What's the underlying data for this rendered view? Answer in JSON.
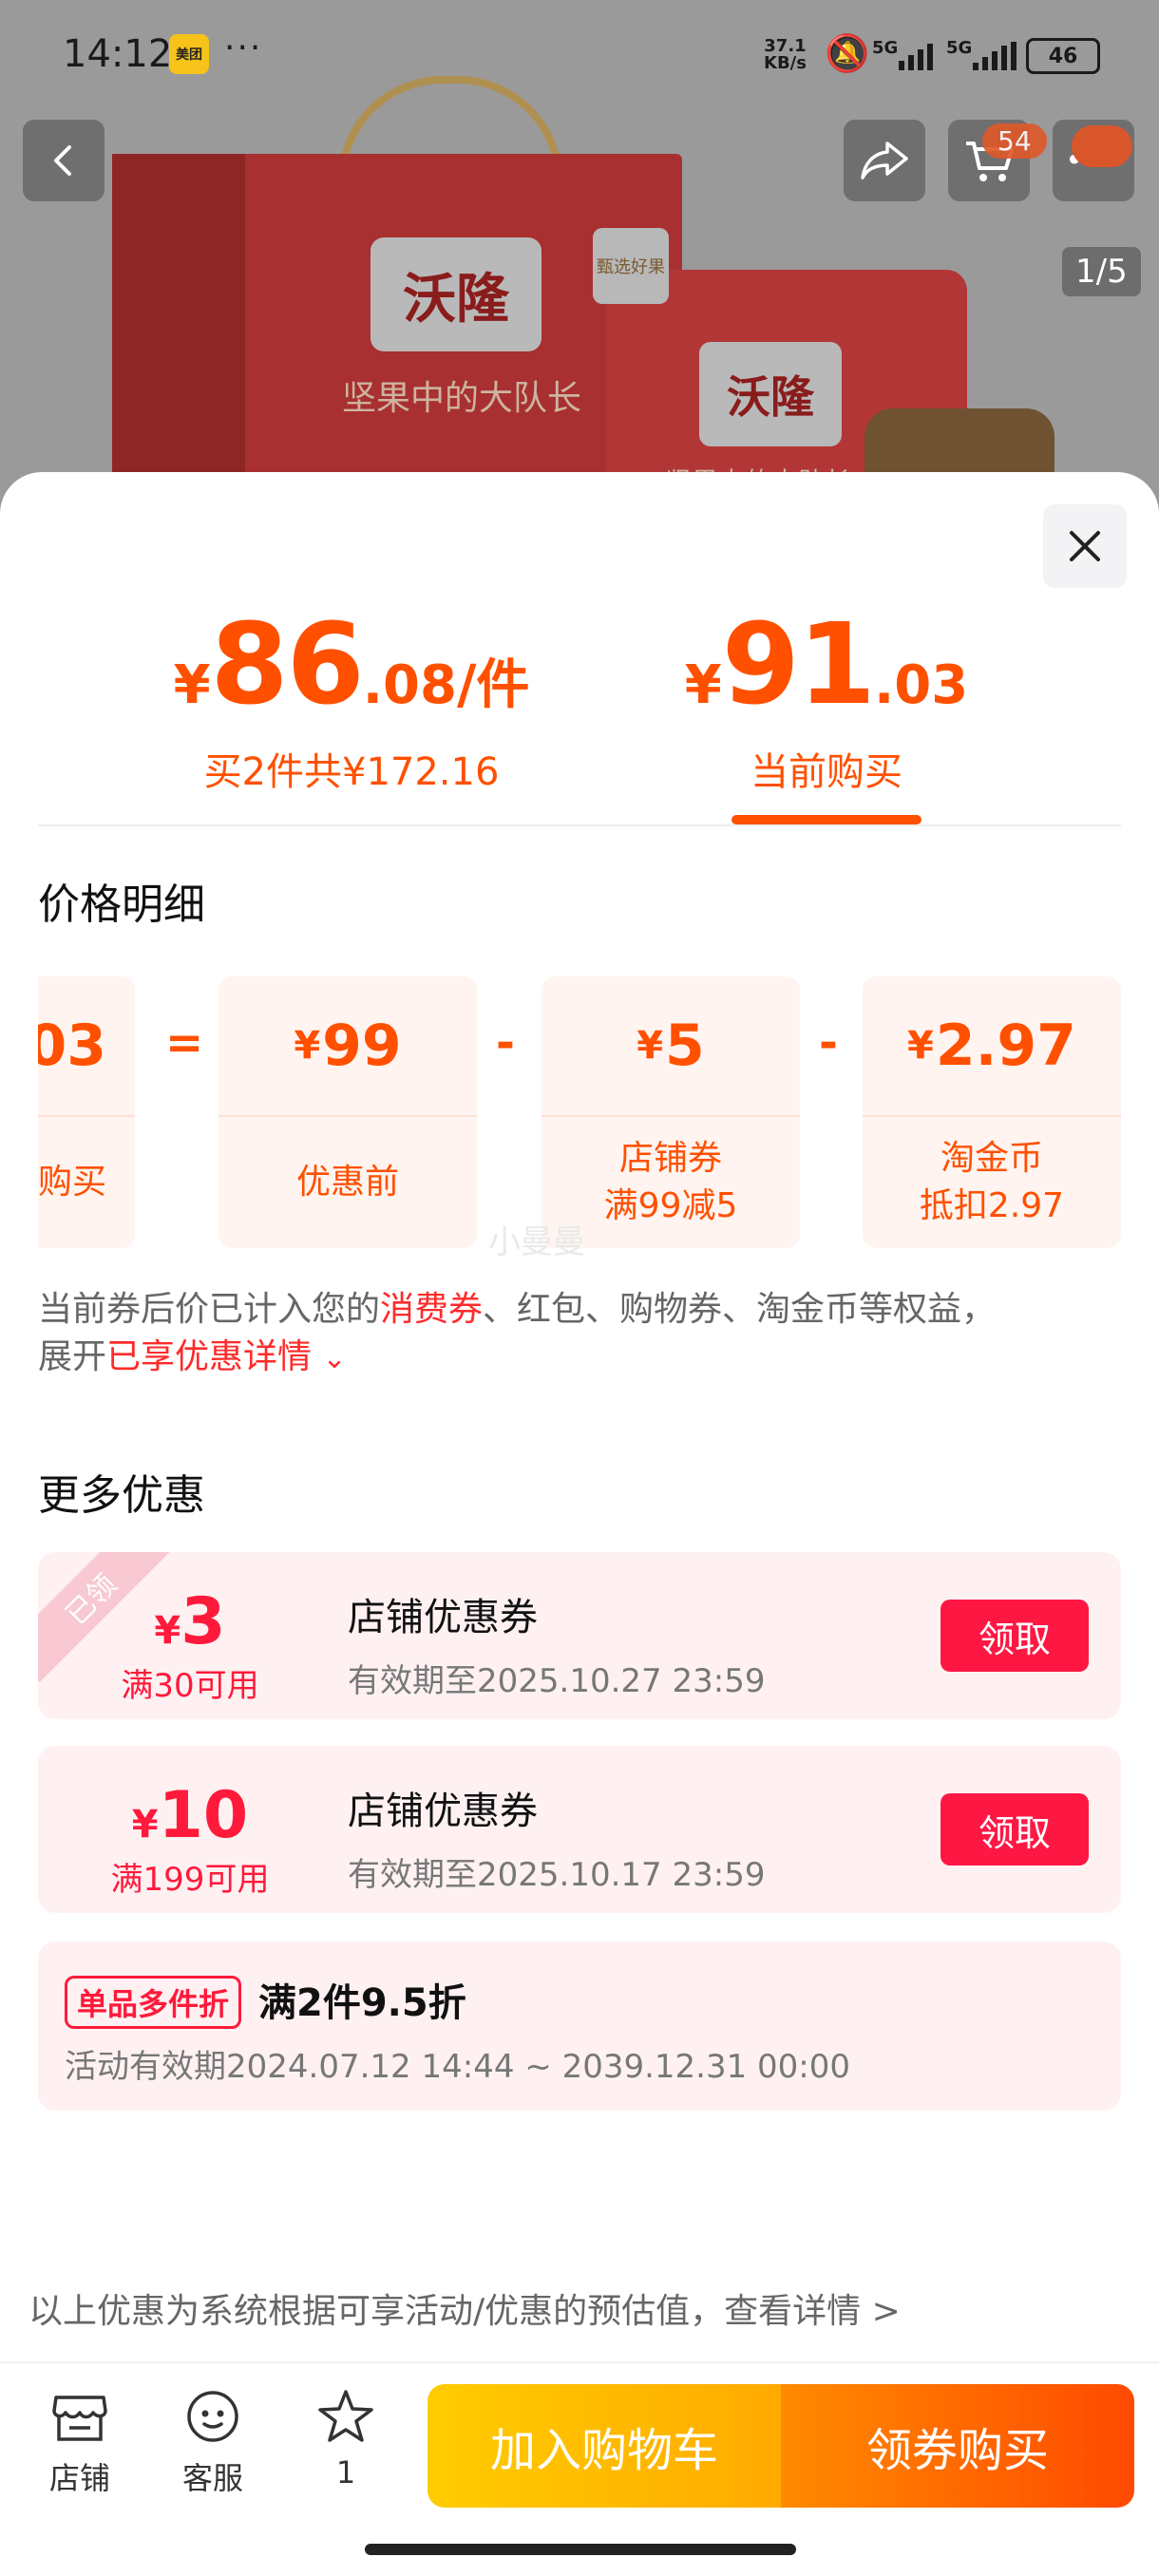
{
  "status_bar": {
    "time": "14:12",
    "app_badge": "美团",
    "dots": "···",
    "net_speed_top": "37.1",
    "net_speed_unit": "KB/s",
    "sim1": "5G",
    "sim2": "5G",
    "battery": "46"
  },
  "product_header": {
    "cart_count": "54",
    "image_counter": "1/5",
    "brand": "沃隆",
    "slogan": "坚果中的大队长",
    "bag_slogan": "坚果中的大队长",
    "select_tag": "甄选好果"
  },
  "prices": {
    "multi": {
      "yen": "¥",
      "integer": "86",
      "decimal": ".08/件",
      "subtitle": "买2件共¥172.16"
    },
    "current": {
      "yen": "¥",
      "integer": "91",
      "decimal": ".03",
      "subtitle": "当前购买"
    }
  },
  "price_detail": {
    "title": "价格明细",
    "cards": [
      {
        "value": "03",
        "label": "购买",
        "yen": ""
      },
      {
        "value": "99",
        "label": "优惠前",
        "yen": "¥"
      },
      {
        "value": "5",
        "label": "店铺券",
        "label2": "满99减5",
        "yen": "¥"
      },
      {
        "value": "2.97",
        "label": "淘金币",
        "label2": "抵扣2.97",
        "yen": "¥"
      }
    ],
    "ops": [
      "=",
      "-",
      "-"
    ],
    "note_prefix": "当前券后价已计入您的",
    "note_highlight": "消费券",
    "note_suffix": "、红包、购物券、淘金币等权益，",
    "note_line2_prefix": "展开",
    "note_line2_link": "已享优惠详情",
    "note_chevron": "⌄"
  },
  "watermark": "小曼曼",
  "more_offers": {
    "title": "更多优惠",
    "coupons": [
      {
        "ribbon": "已领",
        "yen": "¥",
        "amount": "3",
        "condition": "满30可用",
        "name": "店铺优惠券",
        "validity": "有效期至2025.10.27 23:59",
        "button": "领取"
      },
      {
        "ribbon": "",
        "yen": "¥",
        "amount": "10",
        "condition": "满199可用",
        "name": "店铺优惠券",
        "validity": "有效期至2025.10.17 23:59",
        "button": "领取"
      }
    ],
    "promo": {
      "tag": "单品多件折",
      "title": "满2件9.5折",
      "period": "活动有效期2024.07.12 14:44 ~ 2039.12.31 00:00"
    }
  },
  "disclaimer": "以上优惠为系统根据可享活动/优惠的预估值，查看详情 >",
  "bottom_bar": {
    "shop": "店铺",
    "service": "客服",
    "favorite_count": "1",
    "add_to_cart": "加入购物车",
    "buy_with_coupon": "领券购买"
  },
  "colors": {
    "accent": "#ff5000",
    "coupon_red": "#ff1744",
    "cta_yellow": "#ffb800",
    "cta_orange": "#ff5a00"
  }
}
